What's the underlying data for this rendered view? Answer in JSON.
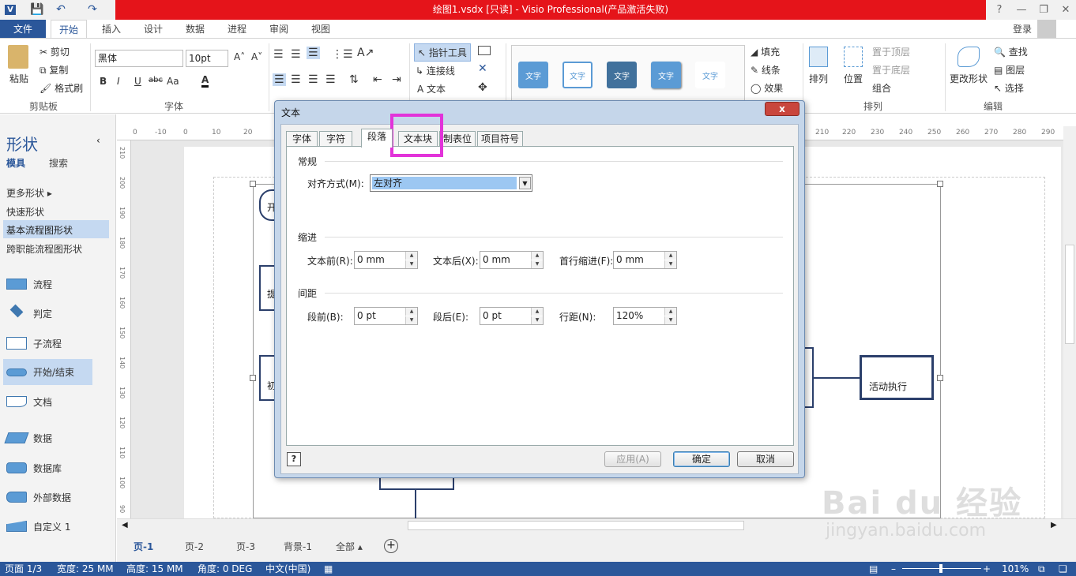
{
  "window": {
    "title": "绘图1.vsdx  [只读] - Visio Professional(产品激活失败)",
    "help": "?",
    "minimize": "—",
    "restore": "❐",
    "close": "✕"
  },
  "ribbon_tabs": [
    "文件",
    "开始",
    "插入",
    "设计",
    "数据",
    "进程",
    "审阅",
    "视图"
  ],
  "account": {
    "signin": "登录"
  },
  "clipboard": {
    "paste": "粘贴",
    "cut": "剪切",
    "copy": "复制",
    "format_painter": "格式刷",
    "label": "剪贴板"
  },
  "font": {
    "name": "黑体",
    "size": "10pt",
    "bold": "B",
    "italic": "I",
    "underline": "U",
    "strike": "abc",
    "case": "Aa",
    "color": "A",
    "label": "字体",
    "grow": "A˄",
    "shrink": "A˅"
  },
  "tools": {
    "pointer": "指针工具",
    "connector": "连接线",
    "text": "文本"
  },
  "shape_styles": {
    "sample": "文字"
  },
  "shape_fmt": {
    "fill": "填充",
    "line": "线条",
    "effect": "效果"
  },
  "arrange": {
    "arrange": "排列",
    "position": "位置",
    "bring_front": "置于顶层",
    "send_back": "置于底层",
    "group": "组合",
    "label": "排列"
  },
  "editing": {
    "change_shape": "更改形状",
    "find": "查找",
    "layers": "图层",
    "select": "选择",
    "label": "编辑"
  },
  "shapes_pane": {
    "title": "形状",
    "tab_stencils": "模具",
    "tab_search": "搜索",
    "more_shapes": "更多形状",
    "quick_shapes": "快速形状",
    "basic_flowchart": "基本流程图形状",
    "cross_functional": "跨职能流程图形状",
    "shapes": [
      "流程",
      "判定",
      "子流程",
      "开始/结束",
      "文档",
      "数据",
      "数据库",
      "外部数据",
      "自定义 1"
    ]
  },
  "ruler": {
    "h_ticks": [
      "0",
      "-10",
      "0",
      "10",
      "20",
      "210",
      "220",
      "230",
      "240",
      "250",
      "260",
      "270",
      "280",
      "290"
    ],
    "v_ticks": [
      "210",
      "200",
      "190",
      "180",
      "170",
      "160",
      "150",
      "140",
      "130",
      "120",
      "110",
      "100",
      "90"
    ]
  },
  "canvas": {
    "shape_labels": [
      "开",
      "提",
      "初",
      "活动执行"
    ]
  },
  "page_tabs": [
    "页-1",
    "页-2",
    "页-3",
    "背景-1",
    "全部"
  ],
  "status": {
    "page": "页面 1/3",
    "width": "宽度: 25 MM",
    "height": "高度: 15 MM",
    "angle": "角度: 0 DEG",
    "language": "中文(中国)",
    "zoom": "101%"
  },
  "dialog": {
    "title": "文本",
    "close": "x",
    "tabs": [
      "字体",
      "字符",
      "段落",
      "文本块",
      "制表位",
      "项目符号"
    ],
    "active_tab": "段落",
    "general": {
      "section": "常规",
      "alignment_label": "对齐方式(M):",
      "alignment_value": "左对齐"
    },
    "indent": {
      "section": "缩进",
      "before_label": "文本前(R):",
      "before_value": "0 mm",
      "after_label": "文本后(X):",
      "after_value": "0 mm",
      "first_label": "首行缩进(F):",
      "first_value": "0 mm"
    },
    "spacing": {
      "section": "间距",
      "before_label": "段前(B):",
      "before_value": "0 pt",
      "after_label": "段后(E):",
      "after_value": "0 pt",
      "line_label": "行距(N):",
      "line_value": "120%"
    },
    "help": "?",
    "apply": "应用(A)",
    "ok": "确定",
    "cancel": "取消"
  },
  "watermark": {
    "brand": "Bai du 经验",
    "url": "jingyan.baidu.com"
  },
  "colors": {
    "accent": "#2b579a",
    "title_red": "#e5141a",
    "highlight": "#e233d9"
  }
}
